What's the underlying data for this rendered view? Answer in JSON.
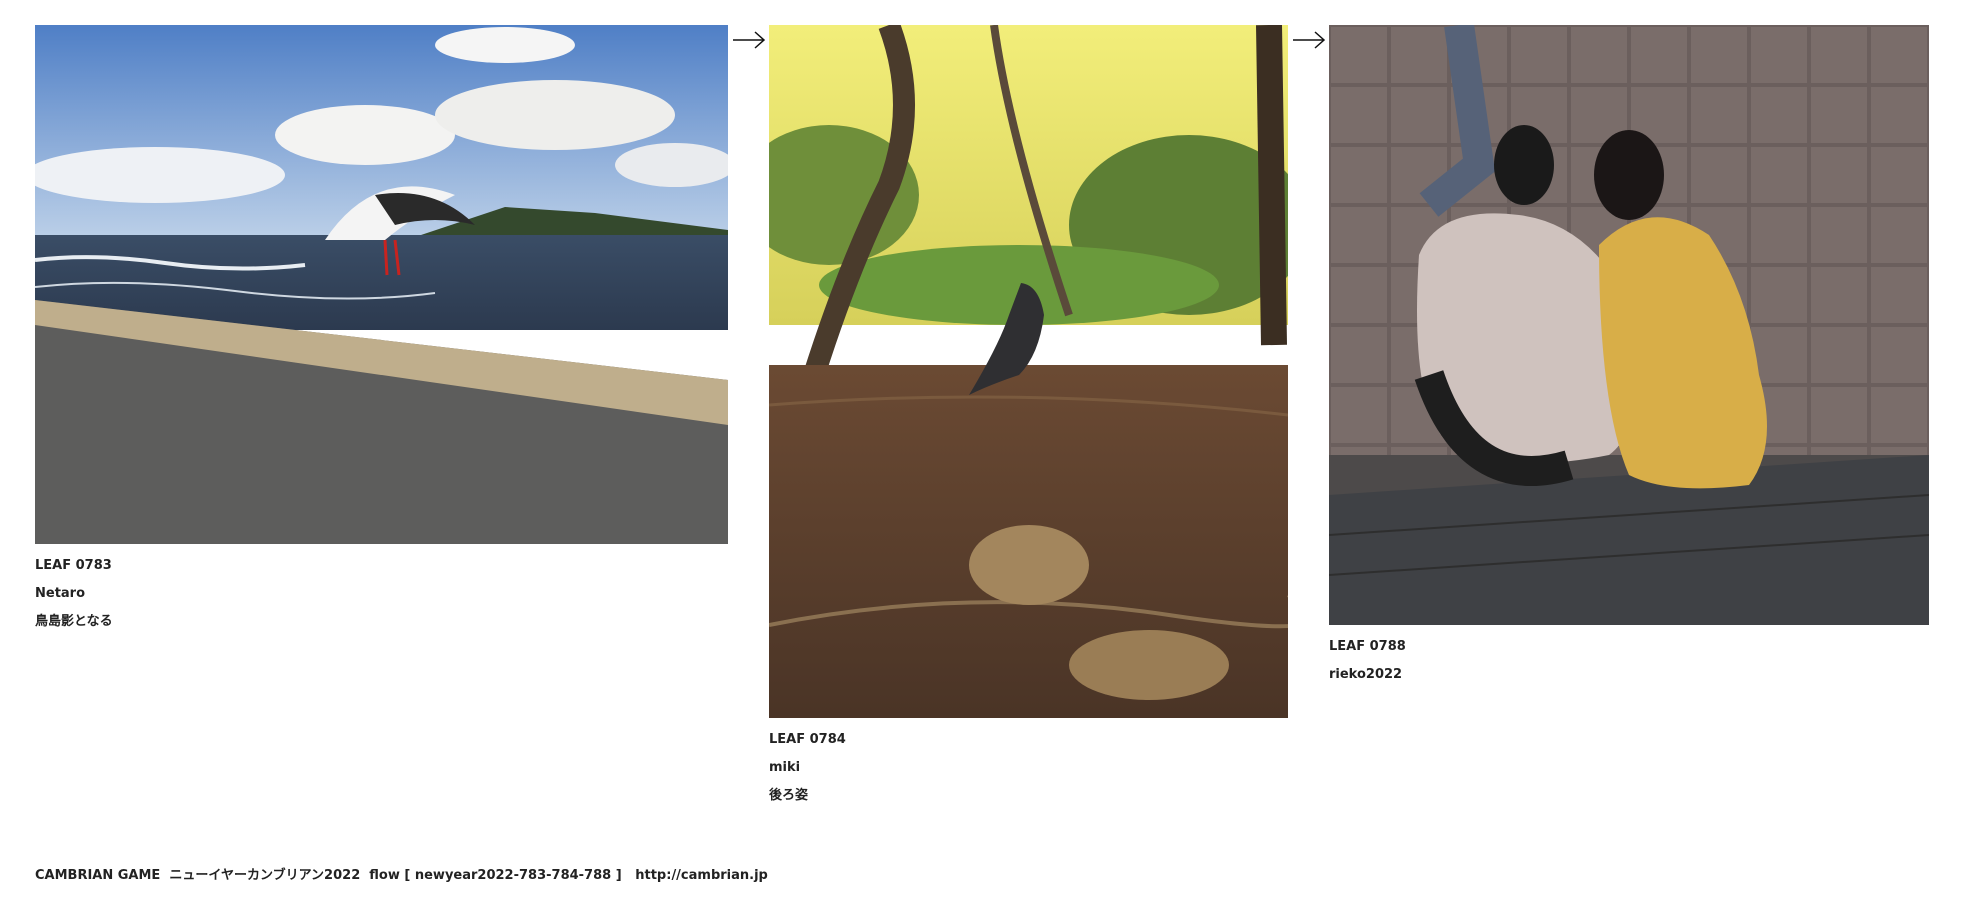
{
  "leaves": [
    {
      "code": "LEAF 0783",
      "author": "Netaro",
      "caption": "鳥島影となる",
      "image": "seagull-over-sea-photo"
    },
    {
      "code": "LEAF 0784",
      "author": "miki",
      "caption": "後ろ姿",
      "image": "crow-in-pine-forest-photo"
    },
    {
      "code": "LEAF 0788",
      "author": "rieko2022",
      "caption": "",
      "image": "couple-sitting-on-steps-photo"
    }
  ],
  "arrows": [
    "arrow-right-icon",
    "arrow-right-icon"
  ],
  "footer": {
    "text": "CAMBRIAN GAME  ニューイヤーカンブリアン2022  flow [ newyear2022-783-784-788 ]   ",
    "link": "http://cambrian.jp"
  }
}
